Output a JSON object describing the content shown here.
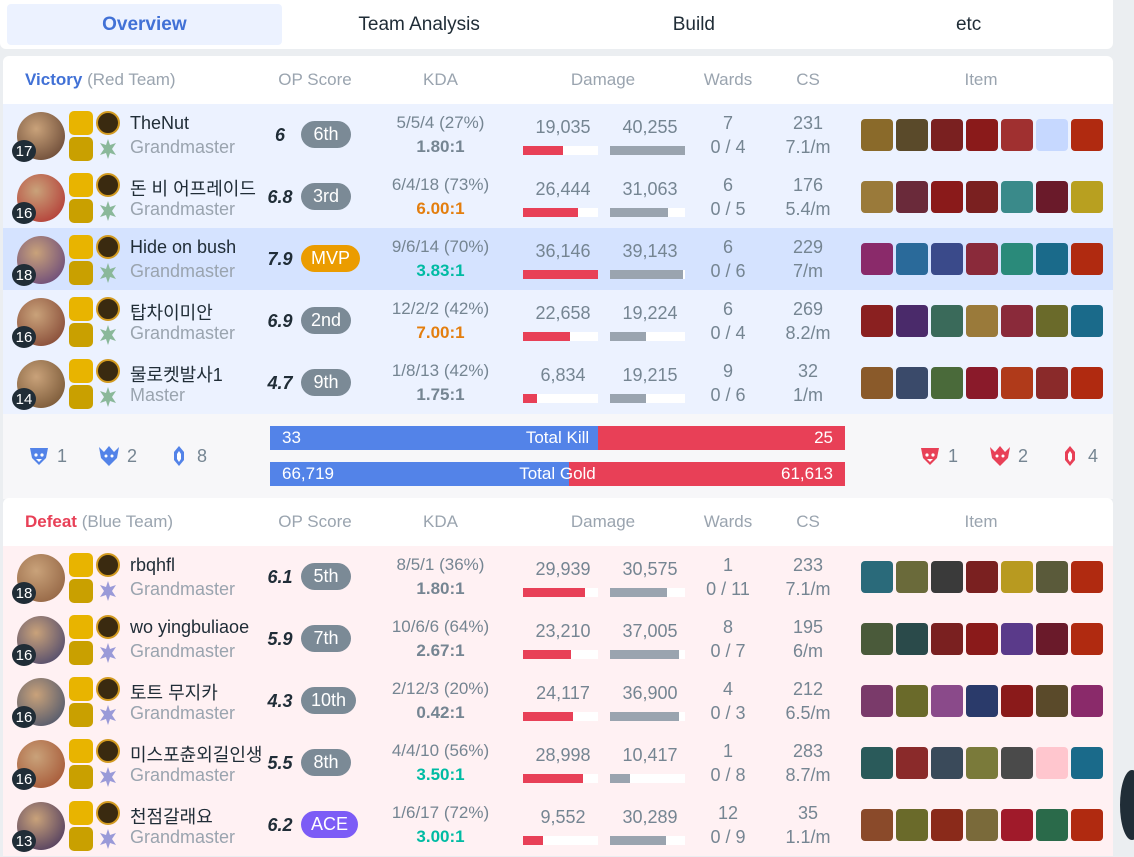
{
  "tabs": [
    "Overview",
    "Team Analysis",
    "Build",
    "etc"
  ],
  "headers": {
    "op": "OP Score",
    "kda": "KDA",
    "damage": "Damage",
    "wards": "Wards",
    "cs": "CS",
    "item": "Item"
  },
  "teams": [
    {
      "result": "Victory",
      "side": "(Red Team)",
      "players": [
        {
          "name": "TheNut",
          "tier": "Grandmaster",
          "level": "17",
          "score": "6",
          "rank": "6th",
          "kda": "5/5/4 (27%)",
          "ratio": "1.80:1",
          "ratio_color": "#758592",
          "dmg": "19,035",
          "taken": "40,255",
          "dmg_pct": 0.53,
          "taken_pct": 1.0,
          "wards": "7",
          "wards2": "0 / 4",
          "cs": "231",
          "csm": "7.1/m",
          "champ": "#5a3a2a",
          "items": [
            "#8a6a2a",
            "#5a4a2a",
            "#7a2020",
            "#8a1a1a",
            "#a03030",
            "#c6d8ff",
            "#b02a10"
          ]
        },
        {
          "name": "돈 비 어프레이드",
          "tier": "Grandmaster",
          "level": "16",
          "score": "6.8",
          "rank": "3rd",
          "kda": "6/4/18 (73%)",
          "ratio": "6.00:1",
          "ratio_color": "#e37e0e",
          "dmg": "26,444",
          "taken": "31,063",
          "dmg_pct": 0.73,
          "taken_pct": 0.77,
          "wards": "6",
          "wards2": "0 / 5",
          "cs": "176",
          "csm": "5.4/m",
          "champ": "#b02a2a",
          "items": [
            "#9a7a3a",
            "#6a2a3a",
            "#8a1a1a",
            "#7a2020",
            "#3a8a8a",
            "#6a1a2a",
            "#b8a020"
          ]
        },
        {
          "name": "Hide on bush",
          "tier": "Grandmaster",
          "level": "18",
          "score": "7.9",
          "rank": "MVP",
          "kda": "9/6/14 (70%)",
          "ratio": "3.83:1",
          "ratio_color": "#00bba3",
          "dmg": "36,146",
          "taken": "39,143",
          "dmg_pct": 1.0,
          "taken_pct": 0.97,
          "wards": "6",
          "wards2": "0 / 6",
          "cs": "229",
          "csm": "7/m",
          "champ": "#5a3a7a",
          "items": [
            "#8a2a6a",
            "#2a6a9a",
            "#3a4a8a",
            "#8a2a3a",
            "#2a8a7a",
            "#1a6a8a",
            "#b02a10"
          ]
        },
        {
          "name": "탑차이미안",
          "tier": "Grandmaster",
          "level": "16",
          "score": "6.9",
          "rank": "2nd",
          "kda": "12/2/2 (42%)",
          "ratio": "7.00:1",
          "ratio_color": "#e37e0e",
          "dmg": "22,658",
          "taken": "19,224",
          "dmg_pct": 0.63,
          "taken_pct": 0.48,
          "wards": "6",
          "wards2": "0 / 4",
          "cs": "269",
          "csm": "8.2/m",
          "champ": "#7a3a2a",
          "items": [
            "#8a2020",
            "#4a2a6a",
            "#3a6a5a",
            "#9a7a3a",
            "#8a2a3a",
            "#6a6a2a",
            "#1a6a8a"
          ]
        },
        {
          "name": "물로켓발사1",
          "tier": "Master",
          "level": "14",
          "score": "4.7",
          "rank": "9th",
          "kda": "1/8/13 (42%)",
          "ratio": "1.75:1",
          "ratio_color": "#758592",
          "dmg": "6,834",
          "taken": "19,215",
          "dmg_pct": 0.19,
          "taken_pct": 0.48,
          "wards": "9",
          "wards2": "0 / 6",
          "cs": "32",
          "csm": "1/m",
          "champ": "#6a4a2a",
          "items": [
            "#8a5a2a",
            "#3a4a6a",
            "#4a6a3a",
            "#8a1a2a",
            "#b03a1a",
            "#8a2a2a",
            "#b02a10"
          ]
        }
      ],
      "objectives": [
        "1",
        "2",
        "8"
      ],
      "total_kill": {
        "left": "33",
        "label": "Total Kill",
        "right": "25",
        "ratio": 0.57
      },
      "total_gold": {
        "left": "66,719",
        "label": "Total Gold",
        "right": "61,613",
        "ratio": 0.52
      },
      "enemy_objectives": [
        "1",
        "2",
        "4"
      ]
    },
    {
      "result": "Defeat",
      "side": "(Blue Team)",
      "players": [
        {
          "name": "rbqhfl",
          "tier": "Grandmaster",
          "level": "18",
          "score": "6.1",
          "rank": "5th",
          "kda": "8/5/1 (36%)",
          "ratio": "1.80:1",
          "ratio_color": "#758592",
          "dmg": "29,939",
          "taken": "30,575",
          "dmg_pct": 0.83,
          "taken_pct": 0.76,
          "wards": "1",
          "wards2": "0 / 11",
          "cs": "233",
          "csm": "7.1/m",
          "champ": "#8a5a3a",
          "items": [
            "#2a6a7a",
            "#6a6a3a",
            "#3a3a3a",
            "#7a2020",
            "#b89a20",
            "#5a5a3a",
            "#b02a10"
          ]
        },
        {
          "name": "wo yingbuliaoe",
          "tier": "Grandmaster",
          "level": "16",
          "score": "5.9",
          "rank": "7th",
          "kda": "10/6/6 (64%)",
          "ratio": "2.67:1",
          "ratio_color": "#758592",
          "dmg": "23,210",
          "taken": "37,005",
          "dmg_pct": 0.64,
          "taken_pct": 0.92,
          "wards": "8",
          "wards2": "0 / 7",
          "cs": "195",
          "csm": "6/m",
          "champ": "#3a3a6a",
          "items": [
            "#4a5a3a",
            "#2a4a4a",
            "#7a2020",
            "#8a1a1a",
            "#5a3a8a",
            "#6a1a2a",
            "#b02a10"
          ]
        },
        {
          "name": "토트 무지카",
          "tier": "Grandmaster",
          "level": "16",
          "score": "4.3",
          "rank": "10th",
          "kda": "2/12/3 (20%)",
          "ratio": "0.42:1",
          "ratio_color": "#758592",
          "dmg": "24,117",
          "taken": "36,900",
          "dmg_pct": 0.67,
          "taken_pct": 0.92,
          "wards": "4",
          "wards2": "0 / 3",
          "cs": "212",
          "csm": "6.5/m",
          "champ": "#3a4a6a",
          "items": [
            "#7a3a6a",
            "#6a6a2a",
            "#8a4a8a",
            "#2a3a6a",
            "#8a1a1a",
            "#5a4a2a",
            "#8a2a6a"
          ]
        },
        {
          "name": "미스포츈외길인생",
          "tier": "Grandmaster",
          "level": "16",
          "score": "5.5",
          "rank": "8th",
          "kda": "4/4/10 (56%)",
          "ratio": "3.50:1",
          "ratio_color": "#00bba3",
          "dmg": "28,998",
          "taken": "10,417",
          "dmg_pct": 0.8,
          "taken_pct": 0.26,
          "wards": "1",
          "wards2": "0 / 8",
          "cs": "283",
          "csm": "8.7/m",
          "champ": "#a04a2a",
          "items": [
            "#2a5a5a",
            "#8a2a2a",
            "#3a4a5a",
            "#7a7a3a",
            "#4a4a4a",
            "#ffc6ce",
            "#1a6a8a"
          ]
        },
        {
          "name": "천점갈래요",
          "tier": "Grandmaster",
          "level": "13",
          "score": "6.2",
          "rank": "ACE",
          "kda": "1/6/17 (72%)",
          "ratio": "3.00:1",
          "ratio_color": "#00bba3",
          "dmg": "9,552",
          "taken": "30,289",
          "dmg_pct": 0.26,
          "taken_pct": 0.75,
          "wards": "12",
          "wards2": "0 / 9",
          "cs": "35",
          "csm": "1.1/m",
          "champ": "#3a2a5a",
          "items": [
            "#8a4a2a",
            "#6a6a2a",
            "#8a2a1a",
            "#7a6a3a",
            "#a01a2a",
            "#2a6a4a",
            "#b02a10"
          ]
        }
      ]
    }
  ],
  "colors": {
    "blue": "#5383e8",
    "red": "#e84057",
    "mvp": "#eb9c00",
    "ace": "#7c5cf6"
  }
}
